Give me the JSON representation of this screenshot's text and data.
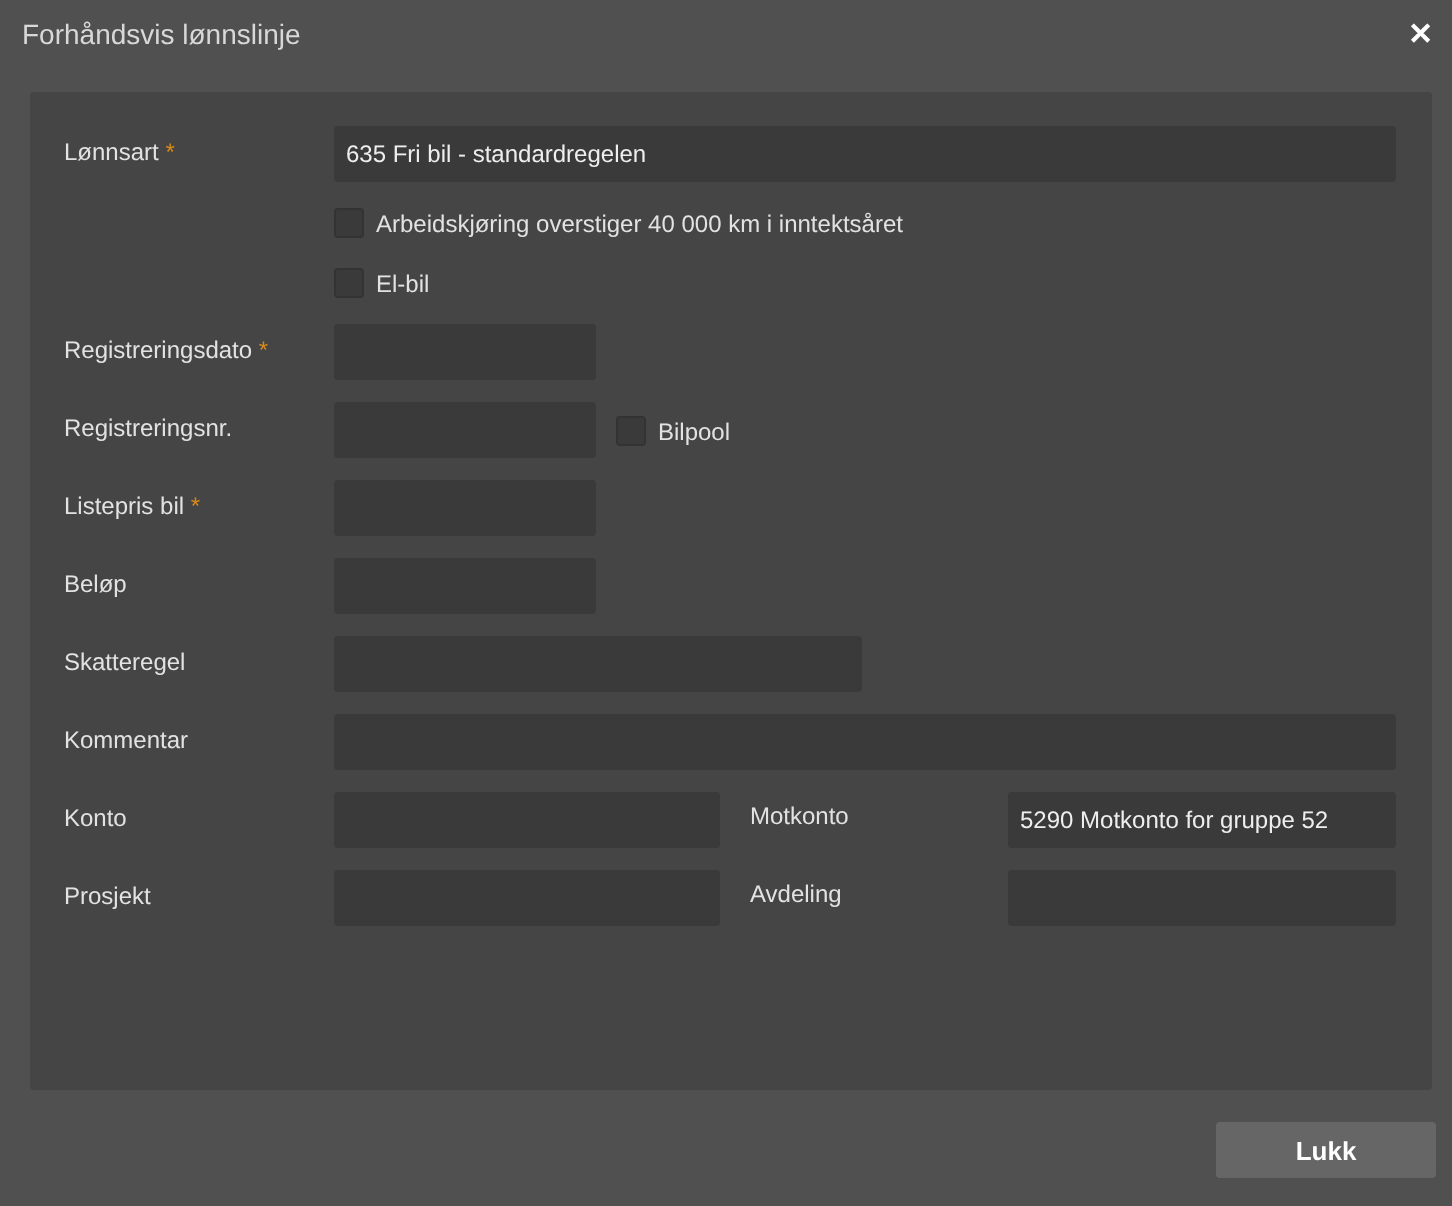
{
  "window": {
    "title": "Forhåndsvis lønnslinje",
    "close": "✕"
  },
  "rows": [
    {
      "kind": "full",
      "label": "Lønnsart",
      "required_mark": "*",
      "value": "635 Fri bil - standardregelen"
    },
    {
      "kind": "checkbox",
      "label": "Arbeidskjøring overstiger 40 000 km i inntektsåret",
      "checked": false
    },
    {
      "kind": "checkbox",
      "label": "El-bil",
      "checked": false
    },
    {
      "kind": "short",
      "label": "Registreringsdato",
      "required_mark": "*"
    },
    {
      "kind": "short",
      "label": "Registreringsnr.",
      "checkbox": {
        "label": "Bilpool",
        "checked": false
      }
    },
    {
      "kind": "short",
      "label": "Listepris bil",
      "required_mark": "*"
    },
    {
      "kind": "short",
      "label": "Beløp"
    },
    {
      "kind": "medium",
      "label": "Skatteregel"
    },
    {
      "kind": "full",
      "label": "Kommentar"
    },
    {
      "kind": "pair",
      "label": "Konto",
      "right": {
        "label": "Motkonto",
        "value": "5290 Motkonto for gruppe 52"
      }
    },
    {
      "kind": "pair",
      "label": "Prosjekt",
      "right": {
        "label": "Avdeling"
      }
    }
  ],
  "buttons": [
    {
      "label": "Lukk"
    }
  ]
}
